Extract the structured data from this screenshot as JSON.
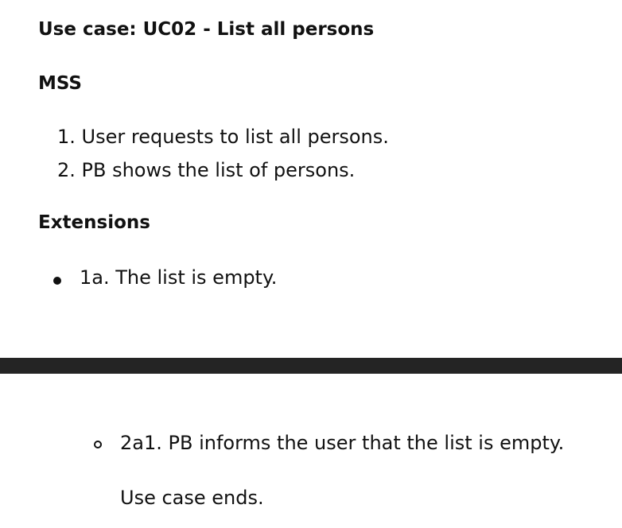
{
  "title": "Use case: UC02 - List all persons",
  "mss_heading": "MSS",
  "mss_steps": [
    "1. User requests to list all persons.",
    "2. PB shows the list of persons."
  ],
  "extensions_heading": "Extensions",
  "extensions": [
    "1a. The list is empty."
  ],
  "sub_extensions": [
    "2a1. PB informs the user that the list is empty."
  ],
  "ending": "Use case ends."
}
